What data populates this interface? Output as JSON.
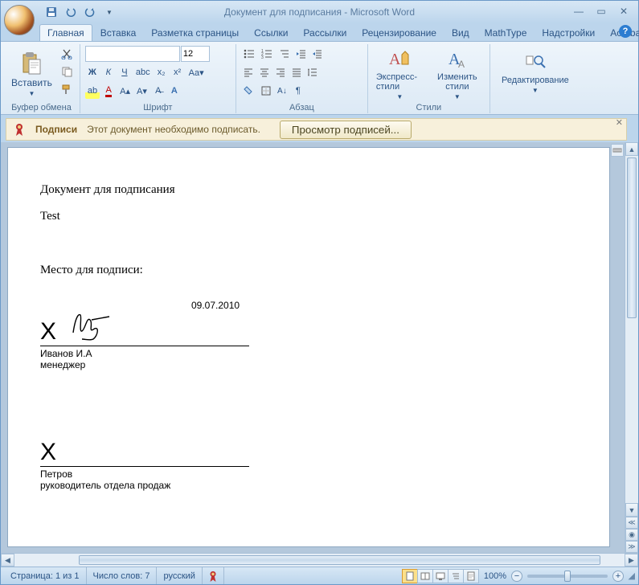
{
  "title": "Документ для подписания - Microsoft Word",
  "tabs": {
    "t0": "Главная",
    "t1": "Вставка",
    "t2": "Разметка страницы",
    "t3": "Ссылки",
    "t4": "Рассылки",
    "t5": "Рецензирование",
    "t6": "Вид",
    "t7": "MathType",
    "t8": "Надстройки",
    "t9": "Acrobat"
  },
  "ribbon": {
    "clipboard": {
      "paste": "Вставить",
      "label": "Буфер обмена"
    },
    "font": {
      "name": "",
      "size": "12",
      "label": "Шрифт",
      "bold": "Ж",
      "italic": "К",
      "underline": "Ч"
    },
    "paragraph": {
      "label": "Абзац"
    },
    "styles": {
      "quick": "Экспресс-стили",
      "change": "Изменить стили",
      "label": "Стили"
    },
    "editing": {
      "label": "Редактирование"
    }
  },
  "sigbar": {
    "title": "Подписи",
    "msg": "Этот документ необходимо подписать.",
    "button": "Просмотр подписей..."
  },
  "document": {
    "heading": "Документ для подписания",
    "test": "Test",
    "place_label": "Место для подписи:",
    "date": "09.07.2010",
    "sig1": {
      "name": "Иванов И.А",
      "role": "менеджер"
    },
    "sig2": {
      "name": "Петров",
      "role": "руководитель отдела продаж"
    }
  },
  "status": {
    "page": "Страница: 1 из 1",
    "words": "Число слов: 7",
    "lang": "русский",
    "zoom": "100%"
  }
}
